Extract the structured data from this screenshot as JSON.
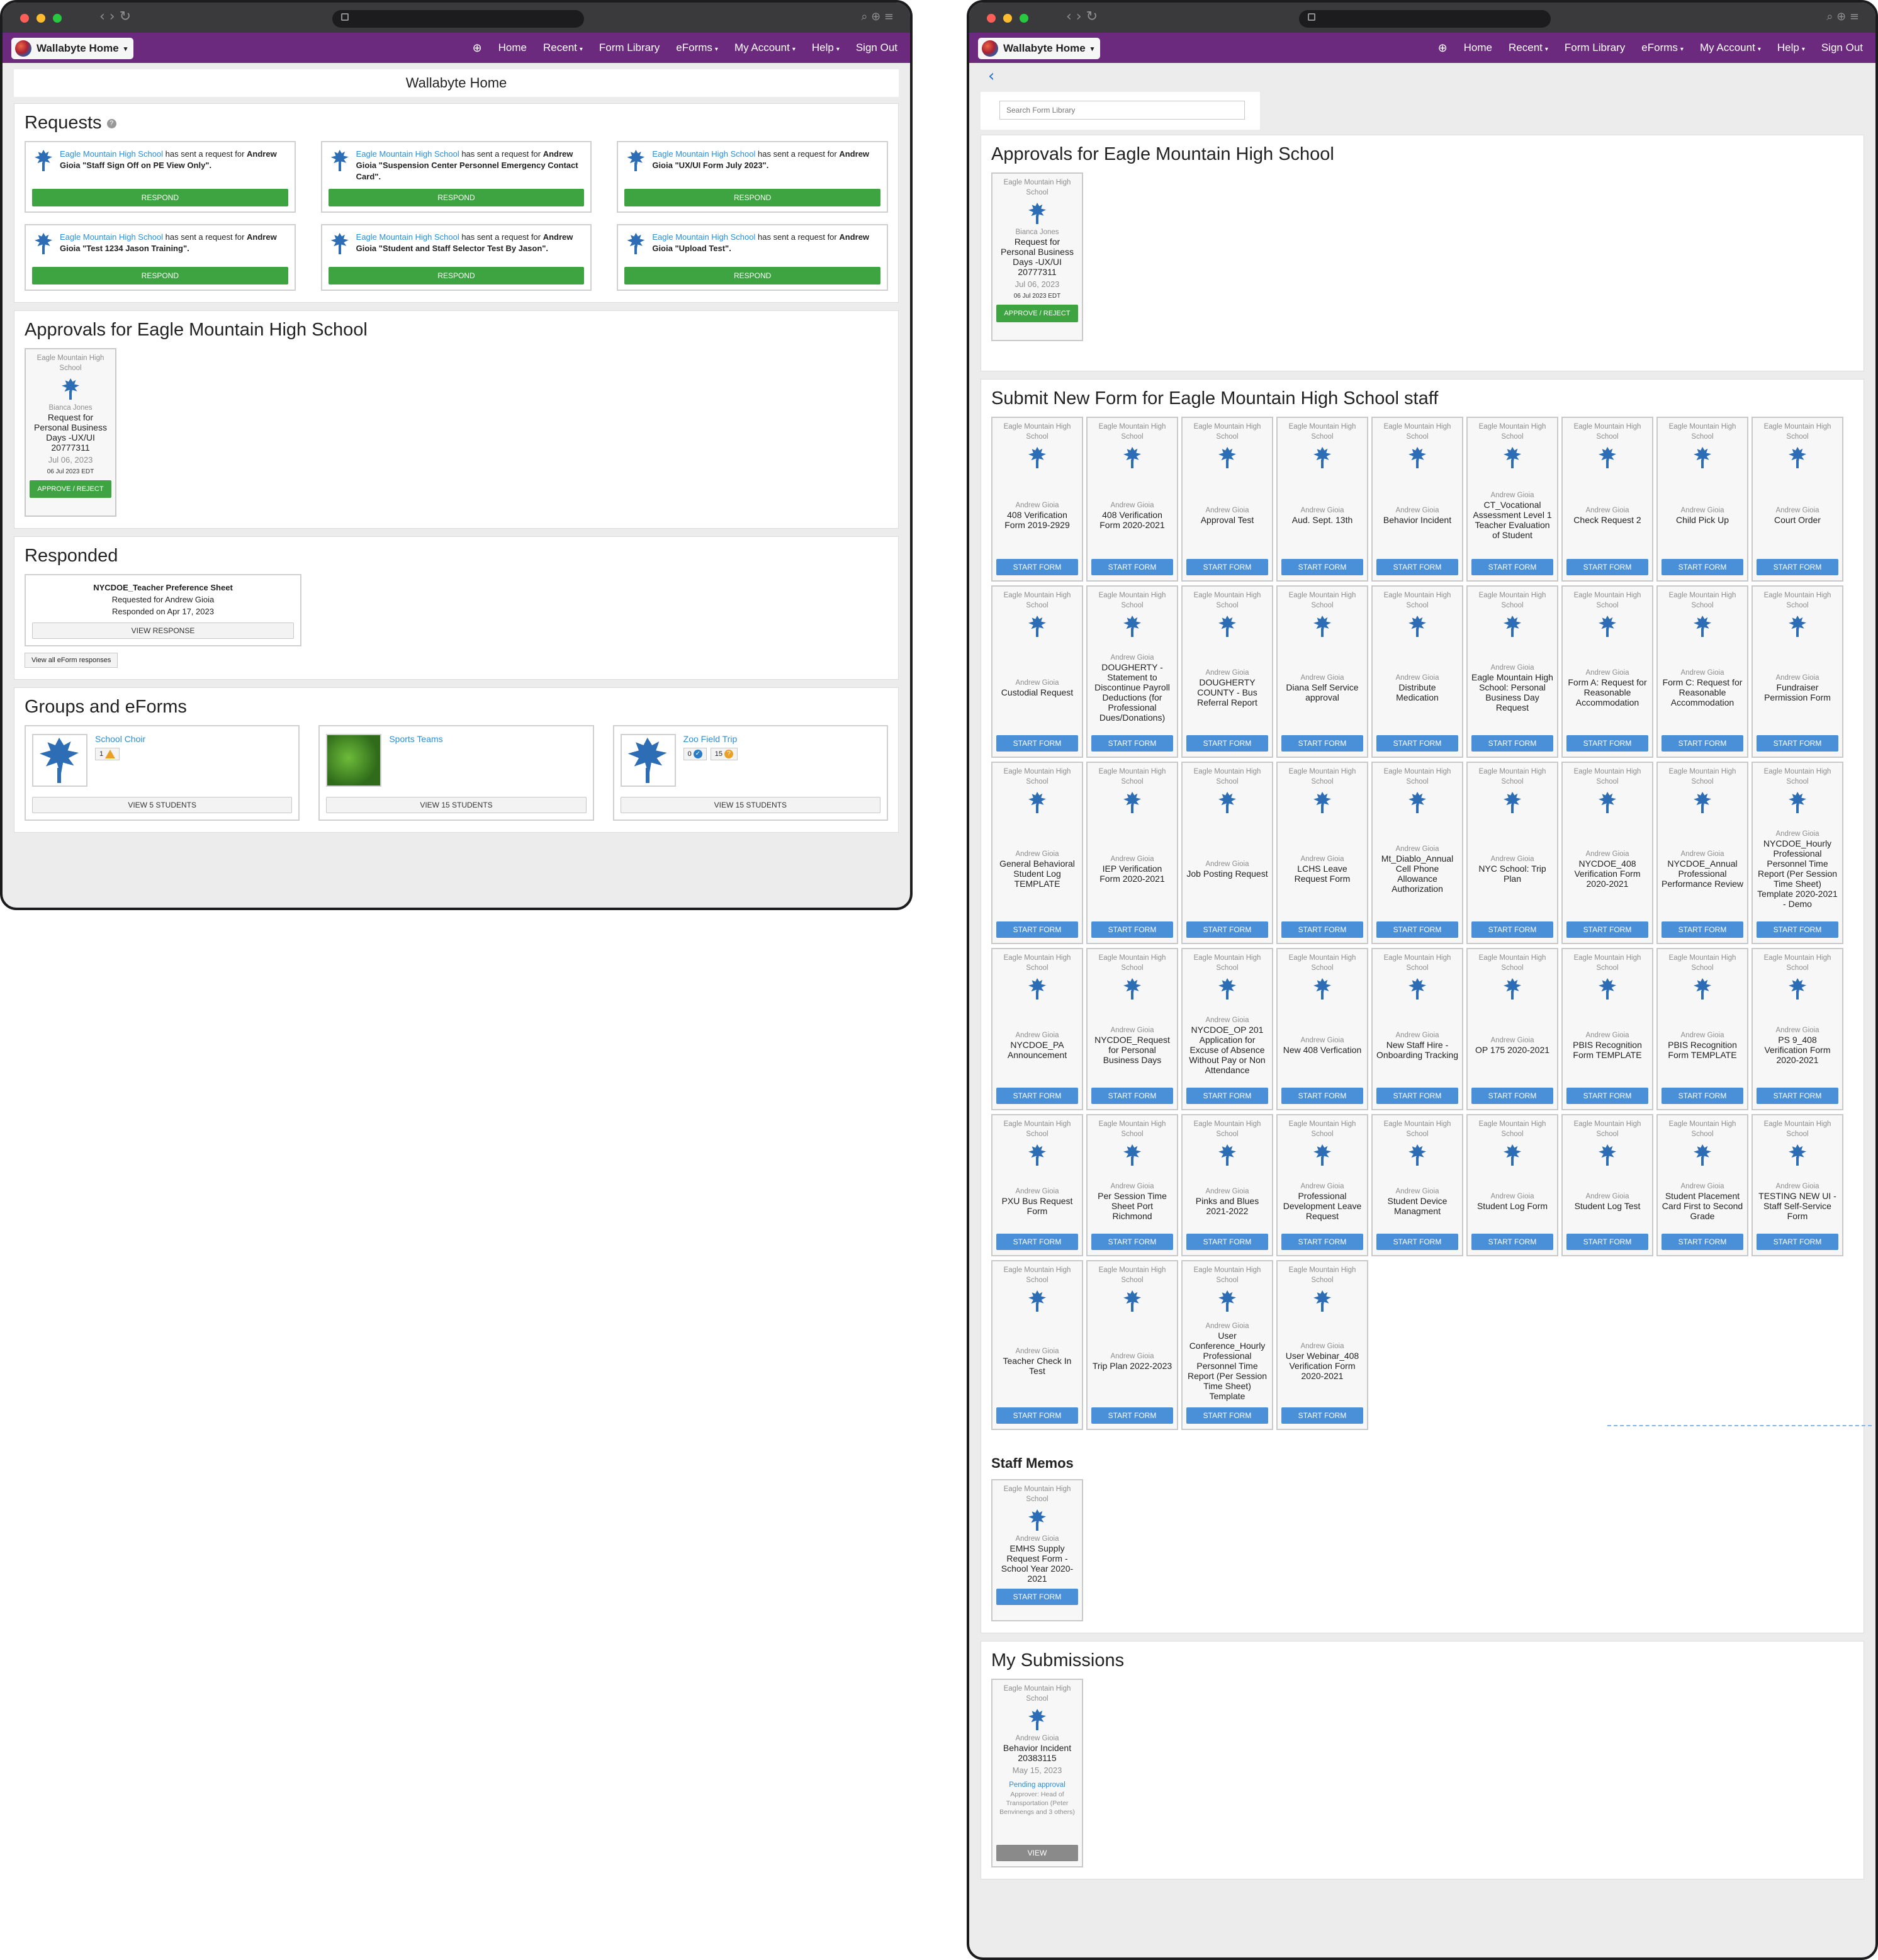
{
  "browser": {
    "nav_glyphs": "‹ › ↻",
    "right_glyphs": "⌕ ⊕ ≡"
  },
  "app": {
    "brand": "Wallabyte Home",
    "nav": [
      {
        "label": "Home",
        "caret": false
      },
      {
        "label": "Recent",
        "caret": true
      },
      {
        "label": "Form Library",
        "caret": false
      },
      {
        "label": "eForms",
        "caret": true
      },
      {
        "label": "My Account",
        "caret": true
      },
      {
        "label": "Help",
        "caret": true
      },
      {
        "label": "Sign Out",
        "caret": false
      }
    ],
    "colors": {
      "navbar": "#6b2a7e",
      "primary": "#4a90d9",
      "success": "#3ea341",
      "link": "#2a8ed6"
    }
  },
  "left": {
    "page_title": "Wallabyte Home",
    "requests": {
      "heading": "Requests",
      "help": "?",
      "respond_label": "RESPOND",
      "items": [
        {
          "school": "Eagle Mountain High School",
          "text": " has sent a request for ",
          "person": "Andrew Gioia",
          "form": " \"Staff Sign Off on PE View Only\"."
        },
        {
          "school": "Eagle Mountain High School",
          "text": " has sent a request for ",
          "person": "Andrew Gioia",
          "form": " \"Suspension Center Personnel Emergency Contact Card\"."
        },
        {
          "school": "Eagle Mountain High School",
          "text": " has sent a request for ",
          "person": "Andrew Gioia",
          "form": " \"UX/UI Form July 2023\"."
        },
        {
          "school": "Eagle Mountain High School",
          "text": " has sent a request for ",
          "person": "Andrew Gioia",
          "form": " \"Test 1234 Jason Training\"."
        },
        {
          "school": "Eagle Mountain High School",
          "text": " has sent a request for ",
          "person": "Andrew Gioia",
          "form": " \"Student and Staff Selector Test By Jason\"."
        },
        {
          "school": "Eagle Mountain High School",
          "text": " has sent a request for ",
          "person": "Andrew Gioia",
          "form": " \"Upload Test\"."
        }
      ]
    },
    "approvals": {
      "heading": "Approvals for Eagle Mountain High School",
      "tile": {
        "school": "Eagle Mountain High School",
        "author": "Bianca Jones",
        "name": "Request for Personal Business Days -UX/UI 20777311",
        "date": "Jul 06, 2023",
        "stamp": "06 Jul 2023 EDT",
        "button": "APPROVE / REJECT"
      }
    },
    "responded": {
      "heading": "Responded",
      "card": {
        "title": "NYCDOE_Teacher Preference Sheet",
        "requested": "Requested for Andrew Gioia",
        "responded": "Responded on Apr 17, 2023",
        "button": "VIEW RESPONSE"
      },
      "view_all": "View all eForm responses"
    },
    "groups": {
      "heading": "Groups and eForms",
      "items": [
        {
          "name": "School Choir",
          "badges": [
            "1"
          ],
          "badge_icons": [
            "warning"
          ],
          "button": "VIEW 5 STUDENTS"
        },
        {
          "name": "Sports Teams",
          "badges": [],
          "badge_icons": [],
          "button": "VIEW 15 STUDENTS"
        },
        {
          "name": "Zoo Field Trip",
          "badges": [
            "0",
            "15"
          ],
          "badge_icons": [
            "check",
            "question"
          ],
          "button": "VIEW 15 STUDENTS"
        }
      ]
    }
  },
  "right": {
    "back": "‹",
    "search_placeholder": "Search Form Library",
    "approvals": {
      "heading": "Approvals for Eagle Mountain High School",
      "tile": {
        "school": "Eagle Mountain High School",
        "author": "Bianca Jones",
        "name": "Request for Personal Business Days -UX/UI 20777311",
        "date": "Jul 06, 2023",
        "stamp": "06 Jul 2023 EDT",
        "button": "APPROVE / REJECT"
      }
    },
    "submit": {
      "heading": "Submit New Form for Eagle Mountain High School staff",
      "school": "Eagle Mountain High School",
      "author": "Andrew Gioia",
      "button": "START FORM",
      "forms": [
        "408 Verification Form 2019-2929",
        "408 Verification Form 2020-2021",
        "Approval Test",
        "Aud. Sept. 13th",
        "Behavior Incident",
        "CT_Vocational Assessment Level 1 Teacher Evaluation of Student",
        "Check Request 2",
        "Child Pick Up",
        "Court Order",
        "Custodial Request",
        "DOUGHERTY - Statement to Discontinue Payroll Deductions (for Professional Dues/Donations)",
        "DOUGHERTY COUNTY - Bus Referral Report",
        "Diana Self Service approval",
        "Distribute Medication",
        "Eagle Mountain High School: Personal Business Day Request",
        "Form A: Request for Reasonable Accommodation",
        "Form C: Request for Reasonable Accommodation",
        "Fundraiser Permission Form",
        "General Behavioral Student Log TEMPLATE",
        "IEP Verification Form 2020-2021",
        "Job Posting Request",
        "LCHS Leave Request Form",
        "Mt_Diablo_Annual Cell Phone Allowance Authorization",
        "NYC School: Trip Plan",
        "NYCDOE_408 Verification Form 2020-2021",
        "NYCDOE_Annual Professional Performance Review",
        "NYCDOE_Hourly Professional Personnel Time Report (Per Session Time Sheet) Template 2020-2021 - Demo",
        "NYCDOE_PA Announcement",
        "NYCDOE_Request for Personal Business Days",
        "NYCDOE_OP 201 Application for Excuse of Absence Without Pay or Non Attendance",
        "New 408 Verfication",
        "New Staff Hire - Onboarding Tracking",
        "OP 175 2020-2021",
        "PBIS Recognition Form TEMPLATE",
        "PBIS Recognition Form TEMPLATE",
        "PS 9_408 Verification Form 2020-2021",
        "PXU Bus Request Form",
        "Per Session Time Sheet Port Richmond",
        "Pinks and Blues 2021-2022",
        "Professional Development Leave Request",
        "Student Device Managment",
        "Student Log Form",
        "Student Log Test",
        "Student Placement Card First to Second Grade",
        "TESTING NEW UI - Staff Self-Service Form",
        "Teacher Check In Test",
        "Trip Plan 2022-2023",
        "User Conference_Hourly Professional Personnel Time Report (Per Session Time Sheet) Template",
        "User Webinar_408 Verification Form 2020-2021"
      ]
    },
    "memos": {
      "heading": "Staff Memos",
      "tile": {
        "school": "Eagle Mountain High School",
        "author": "Andrew Gioia",
        "name": "EMHS Supply Request Form - School Year 2020-2021",
        "button": "START FORM"
      }
    },
    "submissions": {
      "heading": "My Submissions",
      "tile": {
        "school": "Eagle Mountain High School",
        "author": "Andrew Gioia",
        "name": "Behavior Incident 20383115",
        "date": "May 15, 2023",
        "status": "Pending approval",
        "approver": "Approver: Head of Transportation (Peter Benvinengs and 3 others)",
        "button": "VIEW"
      }
    }
  }
}
